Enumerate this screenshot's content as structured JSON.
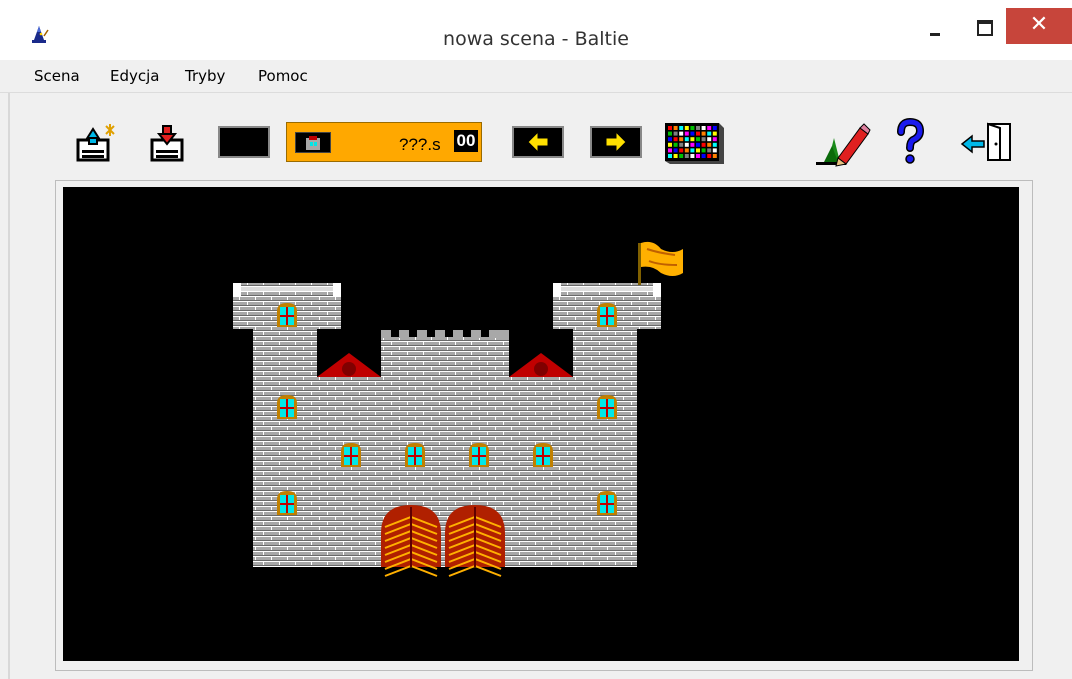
{
  "window": {
    "title": "nowa scena - Baltie",
    "close_glyph": "✕"
  },
  "menu": {
    "items": [
      "Scena",
      "Edycja",
      "Tryby",
      "Pomoc"
    ]
  },
  "toolbar": {
    "counter_text": "???.s",
    "counter_number": "00",
    "icons": [
      "load-scene-icon",
      "save-scene-icon",
      "black-tile-icon",
      "scene-preview-icon",
      "arrow-left-icon",
      "arrow-right-icon",
      "grid-palette-icon",
      "edit-pencil-icon",
      "help-icon",
      "exit-door-icon"
    ]
  },
  "colors": {
    "counter_bg": "#ffa800",
    "canvas_bg": "#000000",
    "brick": "#a8a8a8",
    "window_glass": "#00e8e8",
    "roof": "#c00000",
    "door": "#b02000",
    "flag": "#ffb000",
    "close_button": "#c7453b"
  }
}
